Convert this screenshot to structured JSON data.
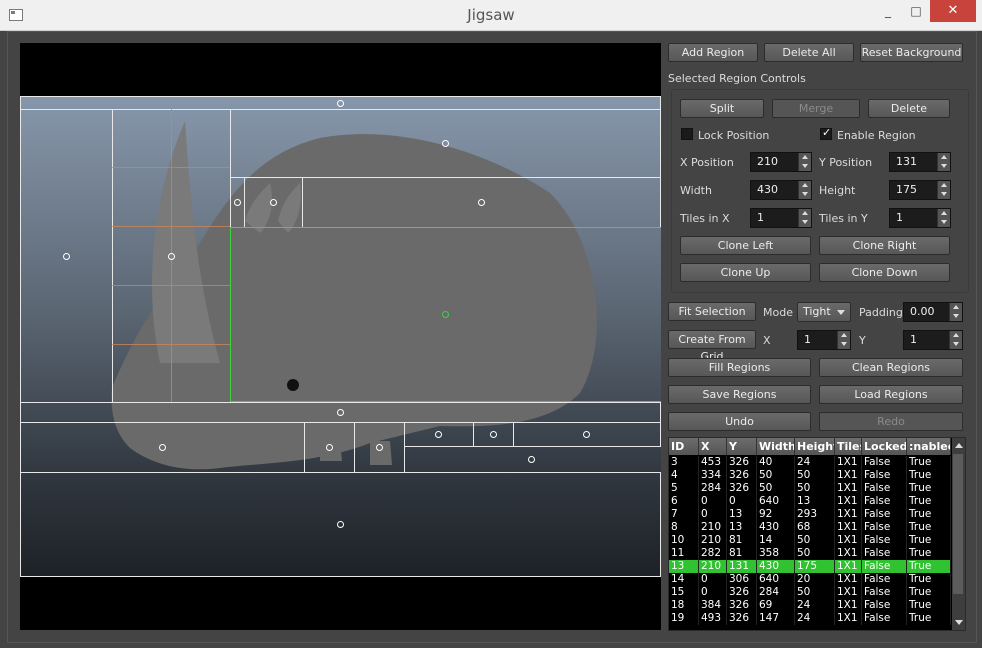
{
  "window": {
    "title": "Jigsaw",
    "min_glyph": "_",
    "max_glyph": "□",
    "close_glyph": "✕"
  },
  "toolbar": {
    "add_region": "Add Region",
    "delete_all": "Delete All",
    "reset_background": "Reset Background"
  },
  "selected": {
    "heading": "Selected Region Controls",
    "split": "Split",
    "merge": "Merge",
    "delete": "Delete",
    "lock_position": "Lock Position",
    "lock_checked": false,
    "enable_region": "Enable Region",
    "enable_checked": true,
    "x_label": "X Position",
    "x_value": "210",
    "y_label": "Y Position",
    "y_value": "131",
    "w_label": "Width",
    "w_value": "430",
    "h_label": "Height",
    "h_value": "175",
    "tx_label": "Tiles in X",
    "tx_value": "1",
    "ty_label": "Tiles in Y",
    "ty_value": "1",
    "clone_left": "Clone Left",
    "clone_right": "Clone Right",
    "clone_up": "Clone Up",
    "clone_down": "Clone Down"
  },
  "fit": {
    "button": "Fit Selection",
    "mode_label": "Mode",
    "mode_value": "Tight",
    "padding_label": "Padding",
    "padding_value": "0.00"
  },
  "grid": {
    "button": "Create From Grid",
    "x_label": "X",
    "x_value": "1",
    "y_label": "Y",
    "y_value": "1"
  },
  "actions": {
    "fill": "Fill Regions",
    "clean": "Clean Regions",
    "save": "Save Regions",
    "load": "Load Regions",
    "undo": "Undo",
    "redo": "Redo"
  },
  "table": {
    "headers": [
      "ID",
      "X",
      "Y",
      "Width",
      "Height",
      "Tiles",
      "Locked",
      ":nablec"
    ],
    "rows": [
      [
        "3",
        "453",
        "326",
        "40",
        "24",
        "1X1",
        "False",
        "True"
      ],
      [
        "4",
        "334",
        "326",
        "50",
        "50",
        "1X1",
        "False",
        "True"
      ],
      [
        "5",
        "284",
        "326",
        "50",
        "50",
        "1X1",
        "False",
        "True"
      ],
      [
        "6",
        "0",
        "0",
        "640",
        "13",
        "1X1",
        "False",
        "True"
      ],
      [
        "7",
        "0",
        "13",
        "92",
        "293",
        "1X1",
        "False",
        "True"
      ],
      [
        "8",
        "210",
        "13",
        "430",
        "68",
        "1X1",
        "False",
        "True"
      ],
      [
        "10",
        "210",
        "81",
        "14",
        "50",
        "1X1",
        "False",
        "True"
      ],
      [
        "11",
        "282",
        "81",
        "358",
        "50",
        "1X1",
        "False",
        "True"
      ],
      [
        "13",
        "210",
        "131",
        "430",
        "175",
        "1X1",
        "False",
        "True"
      ],
      [
        "14",
        "0",
        "306",
        "640",
        "20",
        "1X1",
        "False",
        "True"
      ],
      [
        "15",
        "0",
        "326",
        "284",
        "50",
        "1X1",
        "False",
        "True"
      ],
      [
        "18",
        "384",
        "326",
        "69",
        "24",
        "1X1",
        "False",
        "True"
      ],
      [
        "19",
        "493",
        "326",
        "147",
        "24",
        "1X1",
        "False",
        "True"
      ]
    ],
    "selected_index": 8,
    "selected_color": "#30c230"
  }
}
